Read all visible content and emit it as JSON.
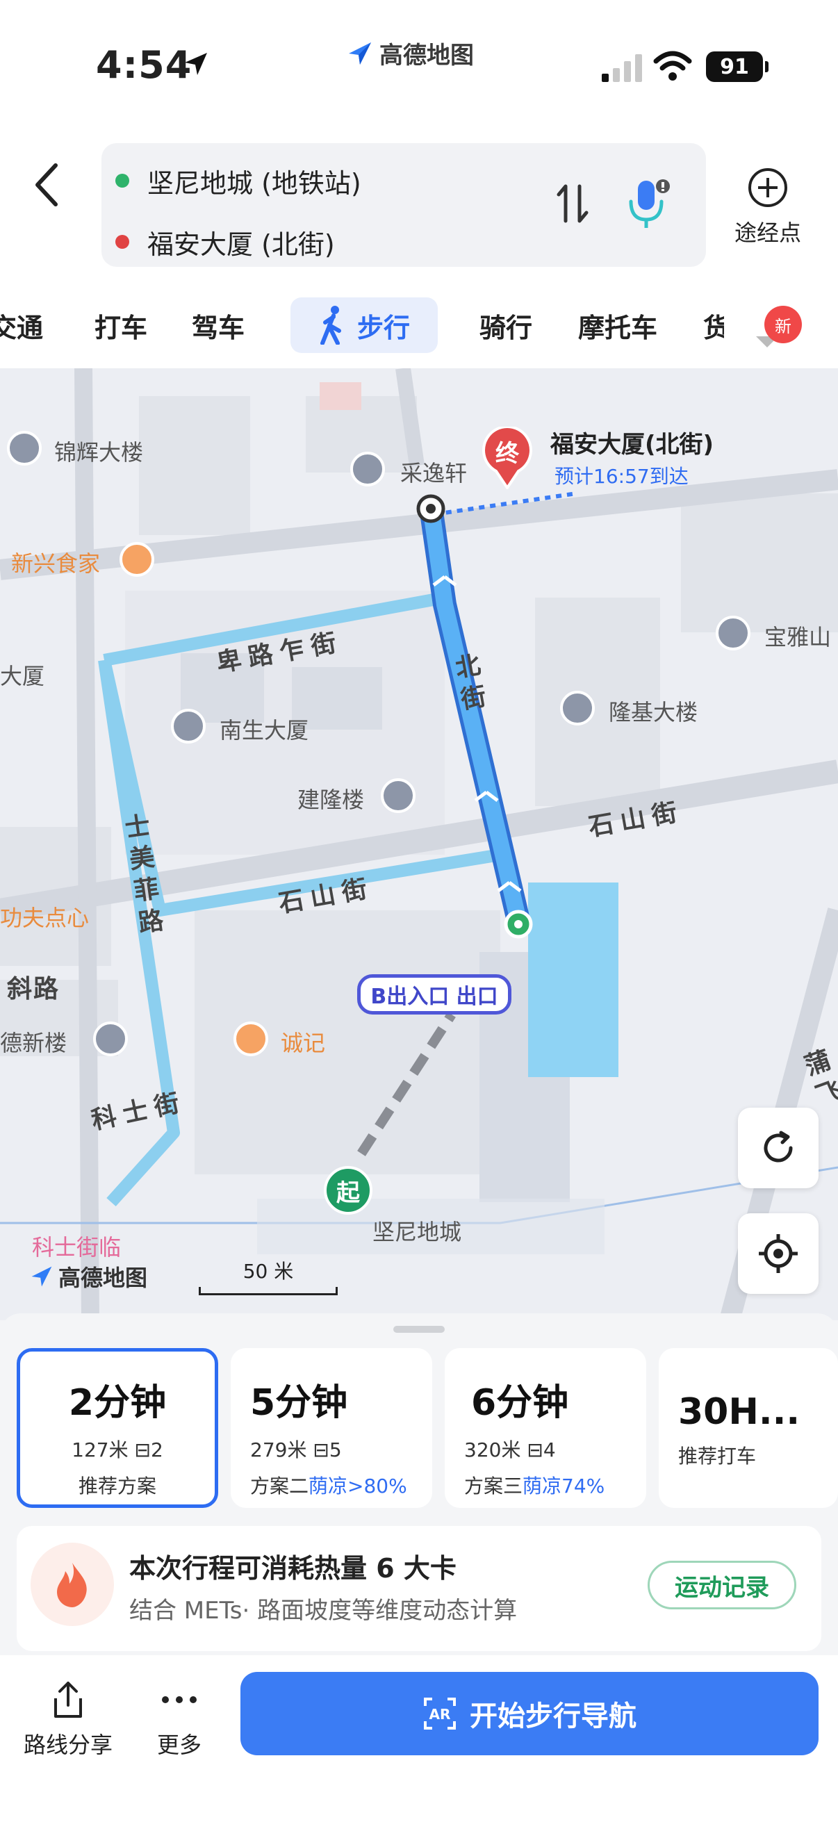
{
  "status": {
    "time": "4:54",
    "battery": "91",
    "app_name": "高德地图"
  },
  "route": {
    "origin": "坚尼地城 (地铁站)",
    "destination": "福安大厦 (北街)",
    "waypoint_label": "途经点"
  },
  "tabs": [
    {
      "label": "交通"
    },
    {
      "label": "打车"
    },
    {
      "label": "驾车"
    },
    {
      "label": "步行"
    },
    {
      "label": "骑行"
    },
    {
      "label": "摩托车"
    },
    {
      "label": "货"
    }
  ],
  "new_badge": "新",
  "map": {
    "dest_name": "福安大厦(北街)",
    "eta": "预计16:57到达",
    "end_marker": "终",
    "start_marker": "起",
    "exit_label": "B出入口 出口",
    "scale": "50 米",
    "logo": "高德地图",
    "pois": [
      "锦辉大楼",
      "采逸轩",
      "新兴食家",
      "宝雅山",
      "大厦",
      "南生大厦",
      "隆基大楼",
      "建隆楼",
      "功夫点心",
      "德新楼",
      "诚记",
      "科士街临",
      "坚尼地城"
    ],
    "streets": [
      "卑路乍街",
      "北街",
      "石山街",
      "石山街",
      "士美菲路",
      "科士街",
      "斜路",
      "蒲飞"
    ]
  },
  "options": [
    {
      "duration": "2分钟",
      "distance": "127米",
      "lights": "2",
      "label": "推荐方案",
      "shade": ""
    },
    {
      "duration": "5分钟",
      "distance": "279米",
      "lights": "5",
      "label": "方案二",
      "shade": "荫凉>80%"
    },
    {
      "duration": "6分钟",
      "distance": "320米",
      "lights": "4",
      "label": "方案三",
      "shade": "荫凉74%"
    },
    {
      "duration": "30H...",
      "distance": "",
      "lights": "",
      "label": "推荐打车",
      "shade": ""
    }
  ],
  "calorie": {
    "title": "本次行程可消耗热量 6 大卡",
    "subtitle": "结合 METs· 路面坡度等维度动态计算",
    "record_button": "运动记录"
  },
  "bottom": {
    "share_label": "路线分享",
    "more_label": "更多",
    "start_nav": "开始步行导航"
  }
}
